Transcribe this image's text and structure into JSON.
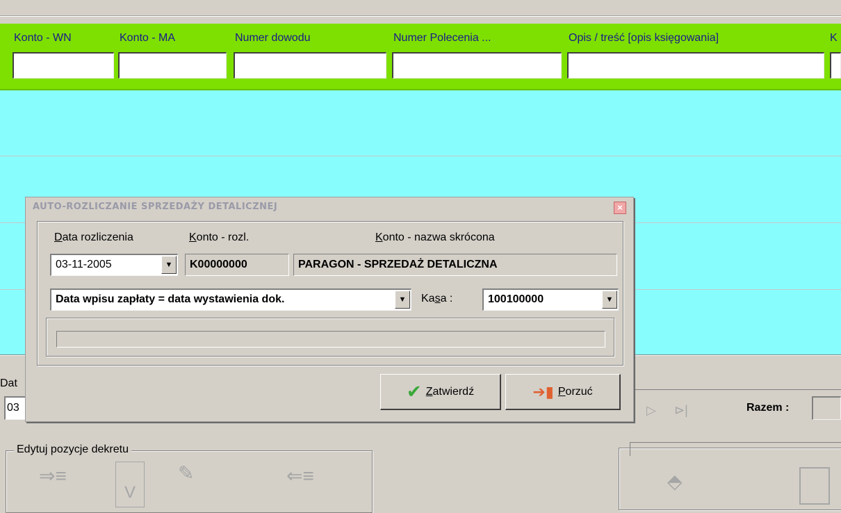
{
  "filters": {
    "konto_wn": "Konto - WN",
    "konto_ma": "Konto - MA",
    "numer_dowodu": "Numer dowodu",
    "numer_polecenia": "Numer Polecenia ...",
    "opis": "Opis / treść [opis księgowania]",
    "cut": "K"
  },
  "lower": {
    "date_label_cut": "Dat",
    "date_value_cut": "03",
    "razem_label": "Razem :",
    "edit_group": "Edytuj  pozycje dekretu"
  },
  "dialog": {
    "title": "AUTO-ROZLICZANIE SPRZEDAŻY DETALICZNEJ",
    "close": "×",
    "date_label": {
      "accel": "D",
      "rest": "ata rozliczenia"
    },
    "account_label": {
      "accel": "K",
      "rest": "onto - rozl."
    },
    "name_label": {
      "accel": "K",
      "rest": "onto - nazwa skrócona"
    },
    "date_value": "03-11-2005",
    "account_value": "K00000000",
    "name_value": "PARAGON - SPRZEDAŻ DETALICZNA",
    "payment_rule": "Data wpisu zapłaty = data wystawienia dok.",
    "kasa_label": {
      "pre": "Ka",
      "accel": "s",
      "post": "a :"
    },
    "kasa_value": "100100000",
    "progress": 0,
    "confirm": {
      "accel": "Z",
      "rest": "atwierdź"
    },
    "cancel": {
      "accel": "P",
      "rest": "orzuć"
    }
  }
}
